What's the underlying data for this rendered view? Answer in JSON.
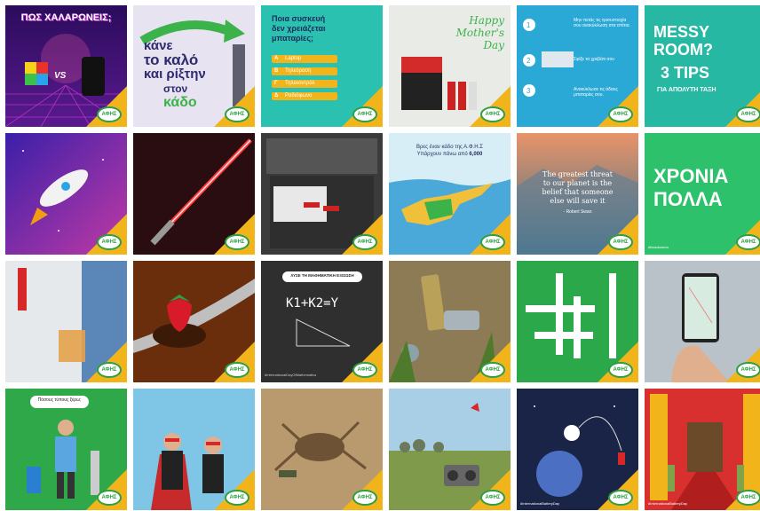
{
  "grid": {
    "logo_text": "ΑΦΗΣ",
    "tiles": [
      {
        "title": "ΠΩΣ ΧΑΛΑΡΩΝΕΙΣ;",
        "vs": "VS"
      },
      {
        "text": [
          "κάνε",
          "το καλό",
          "και ρίξτην",
          "στον",
          "κάδο"
        ]
      },
      {
        "question": [
          "Ποια συσκευή",
          "δεν χρειάζεται",
          "μπαταρίες;"
        ],
        "options": [
          {
            "key": "A",
            "label": "Laptop"
          },
          {
            "key": "B",
            "label": "Τηλεόραση"
          },
          {
            "key": "Γ",
            "label": "Τηλεκοντρόλ"
          },
          {
            "key": "Δ",
            "label": "Ραδιόφωνο"
          }
        ]
      },
      {
        "title": [
          "Happy",
          "Mother's",
          "Day"
        ]
      },
      {
        "steps": [
          "Μην πετάς τις τρισυστοιχία σου ανακύκλωση στα σπίτια.",
          "Σφίξε τα χρεβάτι σου",
          "Ανακύκλωσε τις άδειες μπαταρίες σου."
        ]
      },
      {
        "title": [
          "MESSY",
          "ROOM?"
        ],
        "tips": "3 TIPS",
        "subtitle": "ΓΙΑ ΑΠΟΛΥΤΗ ΤΑΞΗ"
      },
      {
        "alt": "rocket"
      },
      {
        "alt": "lightsaber"
      },
      {
        "alt": "drawer"
      },
      {
        "text": [
          "Βρες έναν κάδο της Α.Φ.Η.Σ",
          "Υπάρχουν πάνω από"
        ],
        "number": "6,000"
      },
      {
        "quote": [
          "The greatest threat",
          "to our planet is the",
          "belief that someone",
          "else will save it"
        ],
        "author": "- Robert Swan"
      },
      {
        "text": [
          "ΧΡΟΝΙΑ",
          "ΠΟΛΛΑ"
        ],
        "tag": "#feasdostem"
      },
      {
        "alt": "juice"
      },
      {
        "alt": "strawberry"
      },
      {
        "header": "ΛΥΣΕ ΤΗ ΜΑΘΗΜΑΤΙΚΗ ΕΞΙΣΩΣΗ",
        "formula": "K1+K2=Y",
        "hashtag": "#InternationalDayOfMathematics"
      },
      {
        "alt": "batteries"
      },
      {
        "alt": "crossword"
      },
      {
        "alt": "phone"
      },
      {
        "bubble": "Πόσους τύπους ξέρω;"
      },
      {
        "alt": "heroes"
      },
      {
        "alt": "crab"
      },
      {
        "alt": "radio"
      },
      {
        "hashtag": "#InternationalBatteryDay"
      },
      {
        "hashtag": "#InternationalBatteryDay"
      }
    ]
  },
  "colors": {
    "accent": "#f2b41b",
    "brand": "#2f9e44"
  }
}
